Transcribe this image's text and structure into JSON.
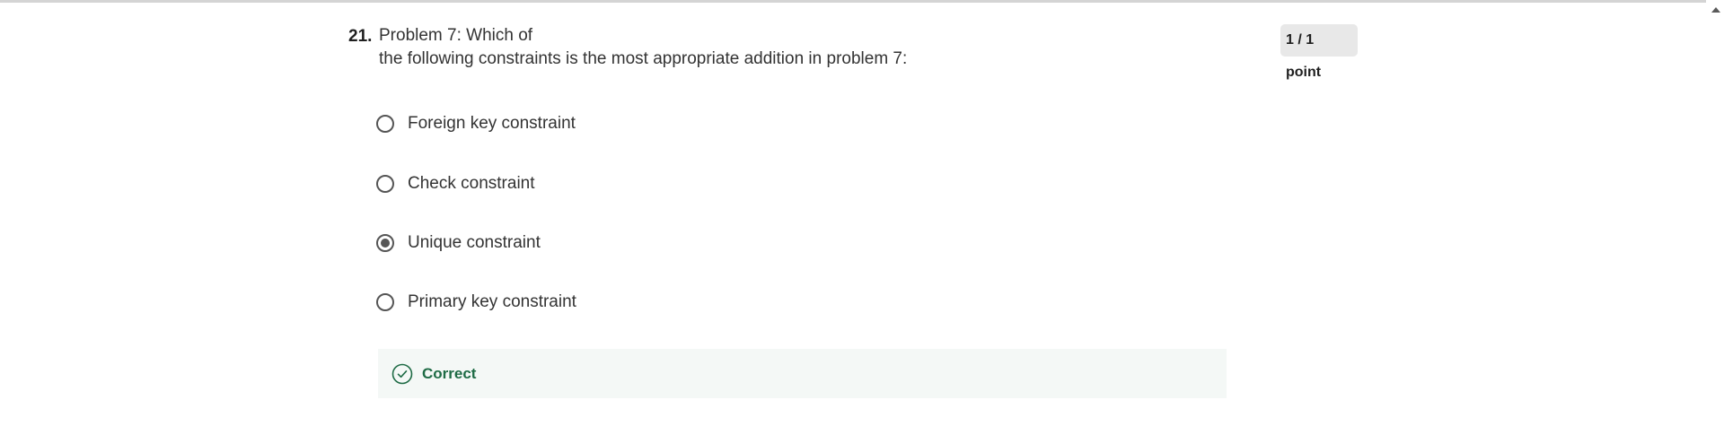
{
  "question": {
    "number": "21.",
    "text_line1": "Problem 7: Which of",
    "text_line2": "the following constraints is the most appropriate addition in problem 7:",
    "points": "1 / 1 point"
  },
  "options": [
    {
      "label": "Foreign key constraint",
      "selected": false
    },
    {
      "label": "Check constraint",
      "selected": false
    },
    {
      "label": "Unique constraint",
      "selected": true
    },
    {
      "label": "Primary key constraint",
      "selected": false
    }
  ],
  "feedback": {
    "label": "Correct",
    "icon": "check-circle-icon",
    "color": "#1e6b45"
  }
}
